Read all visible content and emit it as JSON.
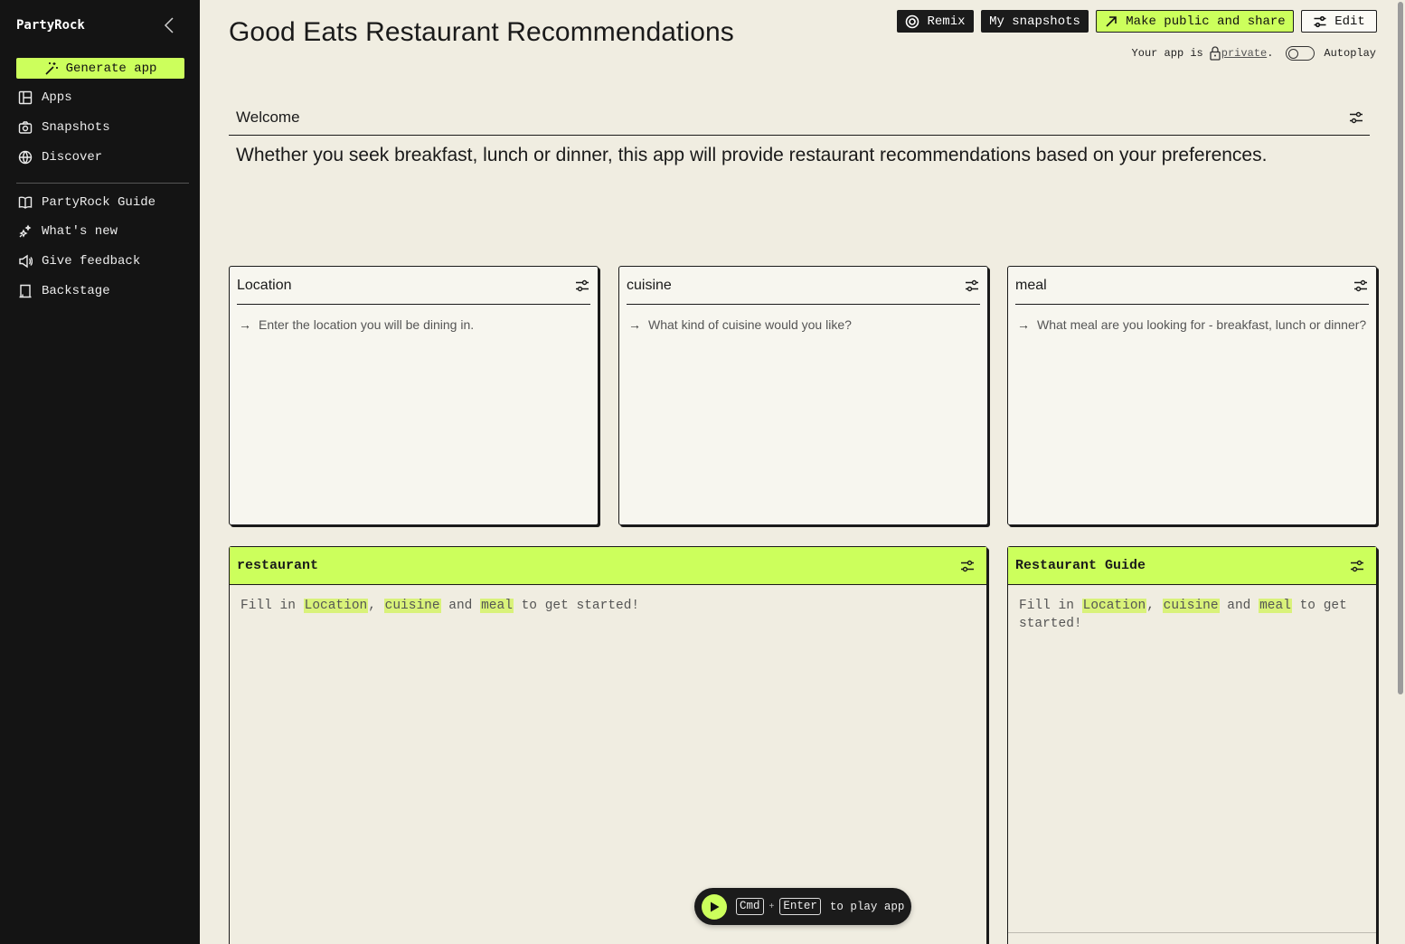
{
  "sidebar": {
    "logo": "PartyRock",
    "generate_label": "Generate app",
    "nav_primary": [
      {
        "label": "Apps",
        "icon": "layout-icon"
      },
      {
        "label": "Snapshots",
        "icon": "camera-icon"
      },
      {
        "label": "Discover",
        "icon": "globe-icon"
      }
    ],
    "nav_secondary": [
      {
        "label": "PartyRock Guide",
        "icon": "book-icon"
      },
      {
        "label": "What's new",
        "icon": "sparkle-icon"
      },
      {
        "label": "Give feedback",
        "icon": "megaphone-icon"
      },
      {
        "label": "Backstage",
        "icon": "backstage-icon"
      }
    ]
  },
  "header": {
    "title": "Good Eats Restaurant Recommendations",
    "remix_label": "Remix",
    "snapshots_label": "My snapshots",
    "share_label": "Make public and share",
    "edit_label": "Edit",
    "status_prefix": "Your app is",
    "status_link": "private",
    "status_suffix": ".",
    "autoplay_label": "Autoplay"
  },
  "welcome": {
    "title": "Welcome",
    "text": "Whether you seek breakfast, lunch or dinner, this app will provide restaurant recommendations based on your preferences."
  },
  "inputs": [
    {
      "title": "Location",
      "placeholder": "Enter the location you will be dining in."
    },
    {
      "title": "cuisine",
      "placeholder": "What kind of cuisine would you like?"
    },
    {
      "title": "meal",
      "placeholder": "What meal are you looking for - breakfast, lunch or dinner?"
    }
  ],
  "outputs": [
    {
      "title": "restaurant",
      "fill_in": "Fill in",
      "ref1": "Location",
      "sep1": ",",
      "ref2": "cuisine",
      "and": "and",
      "ref3": "meal",
      "suffix": "to get started!"
    },
    {
      "title": "Restaurant Guide",
      "fill_in": "Fill in",
      "ref1": "Location",
      "sep1": ",",
      "ref2": "cuisine",
      "and": "and",
      "ref3": "meal",
      "suffix": "to get started!"
    }
  ],
  "playbar": {
    "key1": "Cmd",
    "plus": "+",
    "key2": "Enter",
    "label": "to play app"
  },
  "colors": {
    "accent": "#ccff5c",
    "sidebar_bg": "#141414",
    "page_bg": "#f0ede1"
  }
}
